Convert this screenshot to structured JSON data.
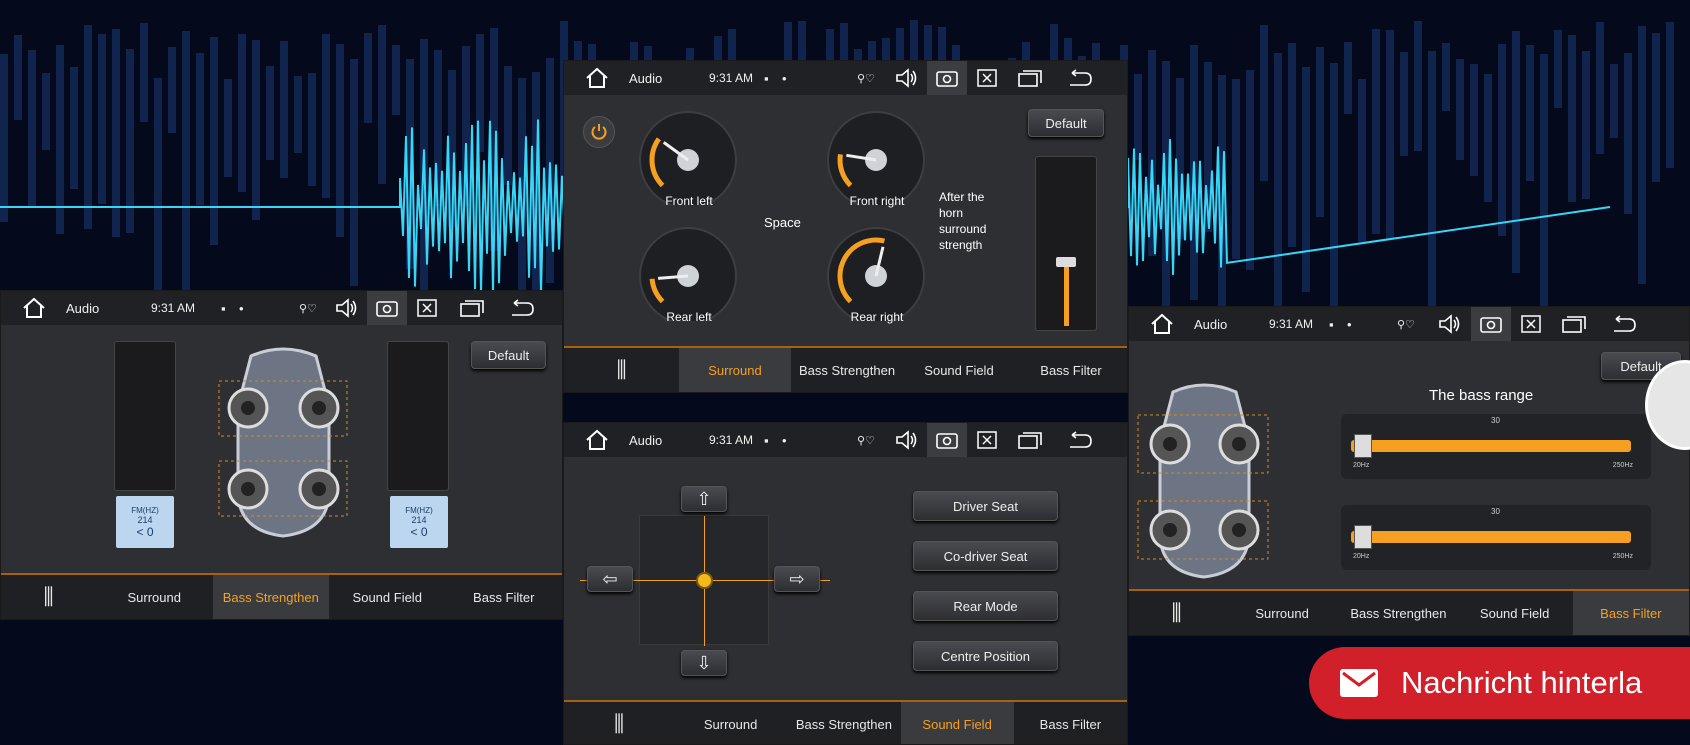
{
  "statusbar": {
    "app_label": "Audio",
    "time": "9:31 AM"
  },
  "panel_left": {
    "default_label": "Default",
    "lcd_unit": "FM(HZ)",
    "lcd_freq": "214",
    "lcd_value": "0",
    "tabs": [
      "Surround",
      "Bass Strengthen",
      "Sound Field",
      "Bass Filter"
    ],
    "active_tab": "Bass Strengthen"
  },
  "panel_top": {
    "default_label": "Default",
    "knobs": [
      {
        "label": "Front left",
        "level": 0.3
      },
      {
        "label": "Front right",
        "level": 0.2
      },
      {
        "label": "Rear left",
        "level": 0.15
      },
      {
        "label": "Rear right",
        "level": 0.55
      }
    ],
    "space_label": "Space",
    "after_horn_label": "After the horn surround strength",
    "tabs": [
      "Surround",
      "Bass Strengthen",
      "Sound Field",
      "Bass Filter"
    ],
    "active_tab": "Surround"
  },
  "panel_bottom": {
    "seat_buttons": [
      "Driver Seat",
      "Co-driver Seat",
      "Rear Mode",
      "Centre Position"
    ],
    "tabs": [
      "Surround",
      "Bass Strengthen",
      "Sound Field",
      "Bass Filter"
    ],
    "active_tab": "Sound Field"
  },
  "panel_right": {
    "default_label": "Default",
    "bass_range_title": "The bass range",
    "bars": [
      {
        "value_label": "30",
        "min_label": "20Hz",
        "max_label": "250Hz",
        "level": 0.02
      },
      {
        "value_label": "30",
        "min_label": "20Hz",
        "max_label": "250Hz",
        "level": 0.02
      }
    ],
    "tabs": [
      "Surround",
      "Bass Strengthen",
      "Sound Field",
      "Bass Filter"
    ],
    "active_tab": "Bass Filter"
  },
  "message_button": {
    "label": "Nachricht hinterla"
  },
  "colors": {
    "accent": "#f5a020",
    "message": "#d2202a",
    "background": "#040a1c"
  }
}
